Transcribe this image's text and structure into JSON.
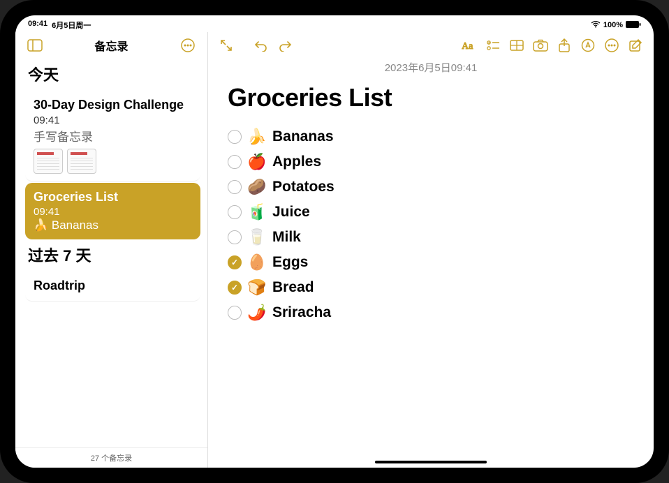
{
  "status": {
    "time": "09:41",
    "date": "6月5日周一",
    "battery": "100%"
  },
  "sidebar": {
    "title": "备忘录",
    "sections": [
      {
        "header": "今天",
        "notes": [
          {
            "title": "30-Day Design Challenge",
            "time": "09:41",
            "preview": "手写备忘录",
            "selected": false,
            "has_thumbs": true
          },
          {
            "title": "Groceries List",
            "time": "09:41",
            "preview": "🍌 Bananas",
            "selected": true,
            "has_thumbs": false
          }
        ]
      },
      {
        "header": "过去 7 天",
        "notes": [
          {
            "title": "Roadtrip",
            "time": "",
            "preview": "",
            "selected": false,
            "has_thumbs": false
          }
        ]
      }
    ],
    "footer": "27 个备忘录"
  },
  "editor": {
    "date": "2023年6月5日09:41",
    "title": "Groceries List",
    "items": [
      {
        "checked": false,
        "emoji": "🍌",
        "label": "Bananas"
      },
      {
        "checked": false,
        "emoji": "🍎",
        "label": "Apples"
      },
      {
        "checked": false,
        "emoji": "🥔",
        "label": "Potatoes"
      },
      {
        "checked": false,
        "emoji": "🧃",
        "label": "Juice"
      },
      {
        "checked": false,
        "emoji": "🥛",
        "label": "Milk"
      },
      {
        "checked": true,
        "emoji": "🥚",
        "label": "Eggs"
      },
      {
        "checked": true,
        "emoji": "🍞",
        "label": "Bread"
      },
      {
        "checked": false,
        "emoji": "🌶️",
        "label": "Sriracha"
      }
    ]
  }
}
